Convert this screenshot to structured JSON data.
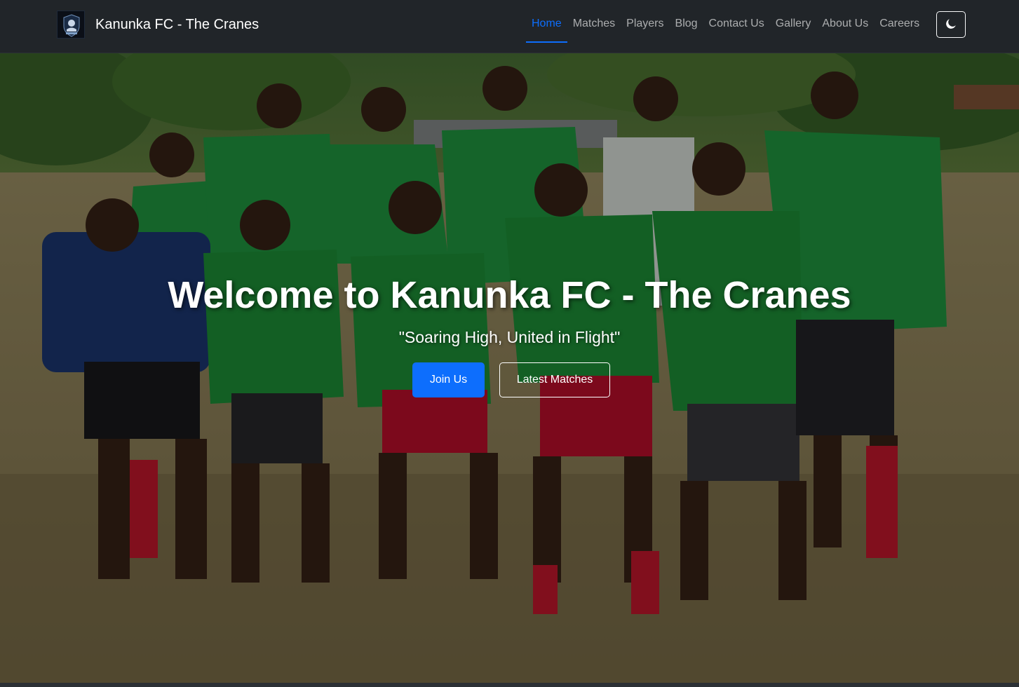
{
  "navbar": {
    "brand": "Kanunka FC - The Cranes",
    "logo_icon": "club-crest-icon",
    "links": [
      {
        "label": "Home",
        "active": true
      },
      {
        "label": "Matches",
        "active": false
      },
      {
        "label": "Players",
        "active": false
      },
      {
        "label": "Blog",
        "active": false
      },
      {
        "label": "Contact Us",
        "active": false
      },
      {
        "label": "Gallery",
        "active": false
      },
      {
        "label": "About Us",
        "active": false
      },
      {
        "label": "Careers",
        "active": false
      }
    ],
    "theme_toggle_icon": "moon-icon"
  },
  "hero": {
    "title": "Welcome to Kanunka FC - The Cranes",
    "tagline": "\"Soaring High, United in Flight\"",
    "primary_button": "Join Us",
    "secondary_button": "Latest Matches",
    "background": "team-photo"
  },
  "colors": {
    "navbar_bg": "#212529",
    "accent": "#0d6efd",
    "jersey_green": "#1f9a3a",
    "shorts_red": "#c8102e",
    "text": "#ffffff"
  }
}
